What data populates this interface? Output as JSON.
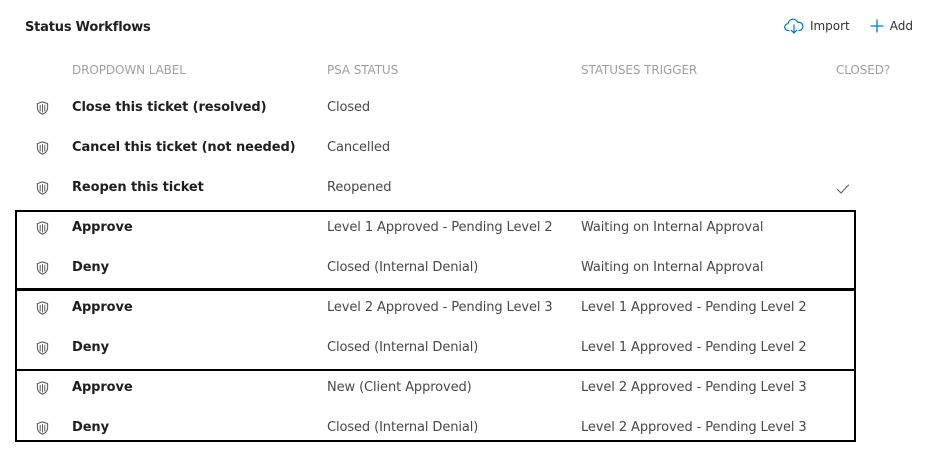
{
  "header": {
    "title": "Status Workflows",
    "import_label": "Import",
    "add_label": "Add"
  },
  "columns": {
    "dropdown_label": "DROPDOWN LABEL",
    "psa_status": "PSA STATUS",
    "statuses_trigger": "STATUSES TRIGGER",
    "closed": "CLOSED?"
  },
  "rows": [
    {
      "icon": "shield-icon",
      "label": "Close this ticket (resolved)",
      "psa_status": "Closed",
      "trigger": "",
      "closed": false
    },
    {
      "icon": "shield-icon",
      "label": "Cancel this ticket (not needed)",
      "psa_status": "Cancelled",
      "trigger": "",
      "closed": false
    },
    {
      "icon": "shield-icon",
      "label": "Reopen this ticket",
      "psa_status": "Reopened",
      "trigger": "",
      "closed": true
    },
    {
      "icon": "shield-icon",
      "label": "Approve",
      "psa_status": "Level 1 Approved - Pending Level 2",
      "trigger": "Waiting on Internal Approval",
      "closed": false
    },
    {
      "icon": "shield-icon",
      "label": "Deny",
      "psa_status": "Closed (Internal Denial)",
      "trigger": "Waiting on Internal Approval",
      "closed": false
    },
    {
      "icon": "shield-icon",
      "label": "Approve",
      "psa_status": "Level 2 Approved - Pending Level 3",
      "trigger": "Level 1 Approved - Pending Level 2",
      "closed": false
    },
    {
      "icon": "shield-icon",
      "label": "Deny",
      "psa_status": "Closed (Internal Denial)",
      "trigger": "Level 1 Approved - Pending Level 2",
      "closed": false
    },
    {
      "icon": "shield-icon",
      "label": "Approve",
      "psa_status": "New (Client Approved)",
      "trigger": "Level 2 Approved - Pending Level 3",
      "closed": false
    },
    {
      "icon": "shield-icon",
      "label": "Deny",
      "psa_status": "Closed (Internal Denial)",
      "trigger": "Level 2 Approved - Pending Level 3",
      "closed": false
    }
  ],
  "colors": {
    "accent": "#0078d4",
    "header_text": "#a19f9d",
    "body_text": "#4a4846",
    "group_border": "#000000"
  }
}
